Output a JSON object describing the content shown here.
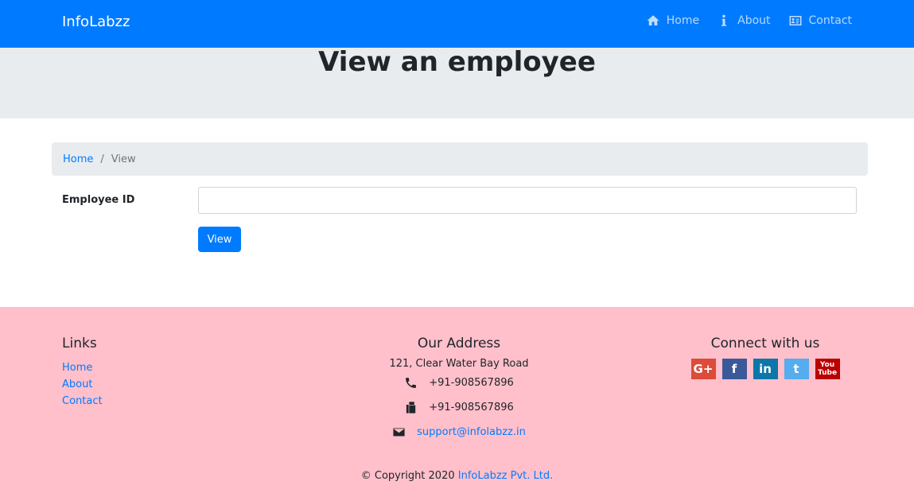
{
  "navbar": {
    "brand": "InfoLabzz",
    "items": [
      {
        "label": "Home",
        "icon": "home-icon"
      },
      {
        "label": "About",
        "icon": "info-icon"
      },
      {
        "label": "Contact",
        "icon": "contact-card-icon"
      }
    ]
  },
  "jumbotron": {
    "title": "View an employee"
  },
  "breadcrumb": {
    "home": "Home",
    "separator": "/",
    "current": "View"
  },
  "form": {
    "employee_id_label": "Employee ID",
    "employee_id_value": "",
    "view_button": "View"
  },
  "footer": {
    "links_heading": "Links",
    "links": [
      "Home",
      "About",
      "Contact"
    ],
    "address_heading": "Our Address",
    "address": "121, Clear Water Bay Road",
    "phone": "+91-908567896",
    "fax": "+91-908567896",
    "email": "support@infolabzz.in",
    "connect_heading": "Connect with us",
    "social": [
      {
        "name": "google-plus-icon",
        "glyph": "G+"
      },
      {
        "name": "facebook-icon",
        "glyph": "f"
      },
      {
        "name": "linkedin-icon",
        "glyph": "in"
      },
      {
        "name": "twitter-icon",
        "glyph": "t"
      },
      {
        "name": "youtube-icon",
        "glyph": "You Tube"
      }
    ],
    "copyright_prefix": "© Copyright 2020",
    "copyright_link": "InfoLabzz Pvt. Ltd."
  },
  "colors": {
    "primary": "#007bff",
    "jumbotron_bg": "#e9ecef",
    "footer_bg": "#ffc0cb"
  }
}
